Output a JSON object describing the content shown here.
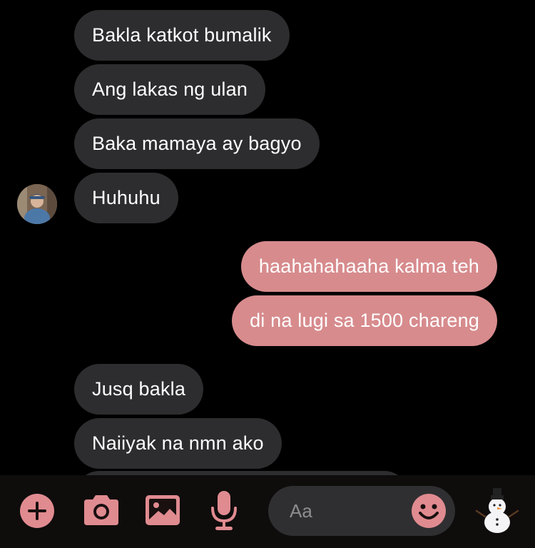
{
  "messages": [
    {
      "sender": "them",
      "text": "Bakla katkot bumalik"
    },
    {
      "sender": "them",
      "text": "Ang lakas ng ulan"
    },
    {
      "sender": "them",
      "text": "Baka mamaya ay bagyo"
    },
    {
      "sender": "them",
      "text": "Huhuhu"
    },
    {
      "sender": "me",
      "text": "haahahahaaha kalma teh"
    },
    {
      "sender": "me",
      "text": "di na lugi sa 1500 chareng"
    },
    {
      "sender": "them",
      "text": "Jusq bakla"
    },
    {
      "sender": "them",
      "text": "Naiiyak na nmn ako"
    }
  ],
  "composer": {
    "placeholder": "Aa"
  },
  "toolbar": {
    "icons": [
      "plus-icon",
      "camera-icon",
      "image-icon",
      "microphone-icon",
      "smiley-icon",
      "snowman-emoji"
    ],
    "quick_reaction": "☃️"
  },
  "colors": {
    "background": "#000000",
    "incoming_bubble": "#2d2d2f",
    "outgoing_bubble": "#d78b8d",
    "accent": "#e08b90",
    "bottom_bar": "#0f0c0c"
  }
}
